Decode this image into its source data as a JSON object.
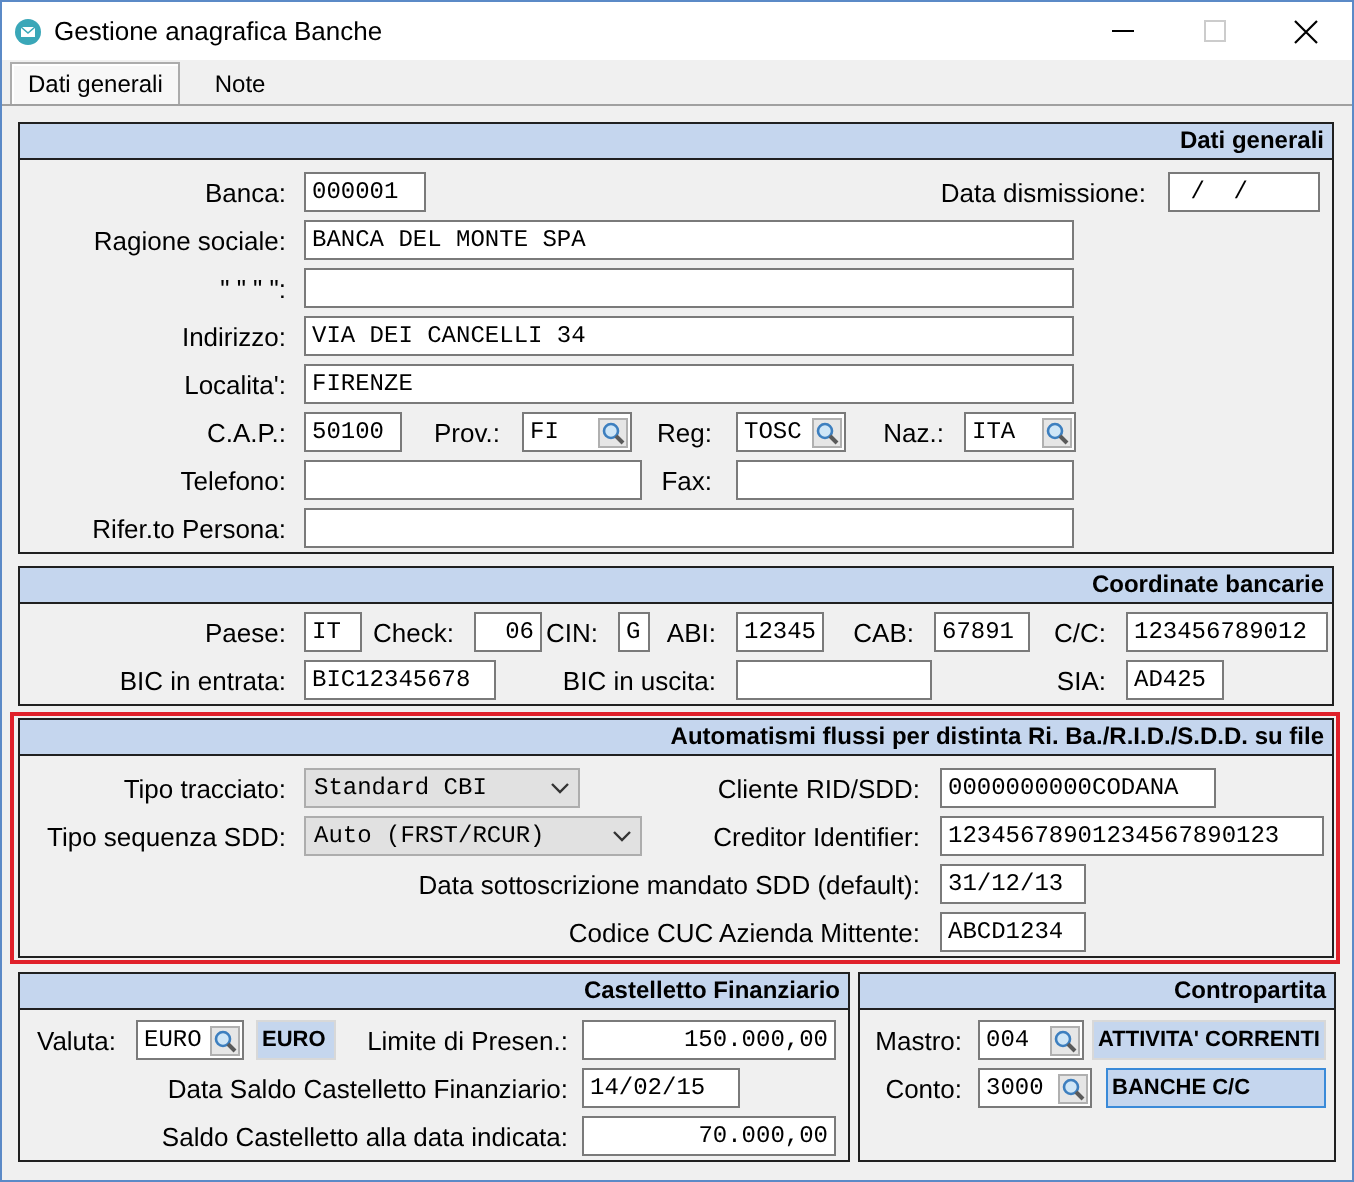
{
  "window": {
    "title": "Gestione anagrafica Banche"
  },
  "tabs": [
    {
      "label": "Dati generali",
      "selected": true
    },
    {
      "label": "Note",
      "selected": false
    }
  ],
  "sections": [
    {
      "title": "Dati generali",
      "highlighted": false,
      "fields": [
        {
          "label": "Banca:",
          "kind": "field",
          "value": "000001"
        },
        {
          "label": "Data dismissione:",
          "kind": "field",
          "value": " /  /"
        },
        {
          "label": "Ragione sociale:",
          "kind": "field",
          "value": "BANCA DEL MONTE SPA"
        },
        {
          "label": "\"  \"  \"  \":",
          "kind": "field"
        },
        {
          "label": "Indirizzo:",
          "kind": "field",
          "value": "VIA DEI CANCELLI 34"
        },
        {
          "label": "Localita':",
          "kind": "field",
          "value": "FIRENZE"
        },
        {
          "label": "C.A.P.:",
          "kind": "field",
          "value": "50100"
        },
        {
          "label": "Prov.:",
          "kind": "lookup",
          "value": "FI"
        },
        {
          "label": "Reg:",
          "kind": "lookup",
          "value": "TOSC"
        },
        {
          "label": "Naz.:",
          "kind": "lookup",
          "value": "ITA"
        },
        {
          "label": "Telefono:",
          "kind": "field"
        },
        {
          "label": "Fax:",
          "kind": "field"
        },
        {
          "label": "Rifer.to Persona:",
          "kind": "field"
        }
      ]
    },
    {
      "title": "Coordinate bancarie",
      "highlighted": false,
      "fields": [
        {
          "label": "Paese:",
          "kind": "field",
          "value": "IT"
        },
        {
          "label": "Check:",
          "kind": "number",
          "value": "06"
        },
        {
          "label": "CIN:",
          "kind": "field",
          "value": "G"
        },
        {
          "label": "ABI:",
          "kind": "field",
          "value": "12345"
        },
        {
          "label": "CAB:",
          "kind": "field",
          "value": "67891"
        },
        {
          "label": "C/C:",
          "kind": "field",
          "value": "123456789012"
        },
        {
          "label": "BIC in entrata:",
          "kind": "field",
          "value": "BIC12345678"
        },
        {
          "label": "BIC in uscita:",
          "kind": "field"
        },
        {
          "label": "SIA:",
          "kind": "field",
          "value": "AD425"
        }
      ]
    },
    {
      "title": "Automatismi flussi per distinta Ri. Ba./R.I.D./S.D.D. su file",
      "highlighted": true,
      "fields": [
        {
          "label": "Tipo tracciato:",
          "kind": "select",
          "value": "Standard CBI"
        },
        {
          "label": "Cliente RID/SDD:",
          "kind": "field",
          "value": "0000000000CODANA"
        },
        {
          "label": "Tipo sequenza SDD:",
          "kind": "select",
          "value": "Auto (FRST/RCUR)"
        },
        {
          "label": "Creditor Identifier:",
          "kind": "field",
          "value": "12345678901234567890123"
        },
        {
          "label": "Data sottoscrizione mandato SDD (default):",
          "kind": "field",
          "value": "31/12/13"
        },
        {
          "label": "Codice CUC Azienda Mittente:",
          "kind": "field",
          "value": "ABCD1234"
        }
      ]
    }
  ],
  "bottom_panels": [
    {
      "title": "Castelletto Finanziario",
      "fields": [
        {
          "label": "Valuta:",
          "kind": "lookup",
          "value": "EURO"
        },
        {
          "kind": "display",
          "value": "EURO",
          "focused": false
        },
        {
          "label": "Limite di Presen.:",
          "kind": "number",
          "value": "150.000,00"
        },
        {
          "label": "Data Saldo Castelletto Finanziario:",
          "kind": "field",
          "value": "14/02/15"
        },
        {
          "label": "Saldo Castelletto alla data indicata:",
          "kind": "number",
          "value": "70.000,00"
        }
      ]
    },
    {
      "title": "Contropartita",
      "fields": [
        {
          "label": "Mastro:",
          "kind": "lookup",
          "value": "004"
        },
        {
          "kind": "display",
          "value": "ATTIVITA' CORRENTI",
          "focused": false
        },
        {
          "label": "Conto:",
          "kind": "lookup",
          "value": "3000"
        },
        {
          "kind": "display",
          "value": "BANCHE C/C",
          "focused": true
        }
      ]
    }
  ]
}
